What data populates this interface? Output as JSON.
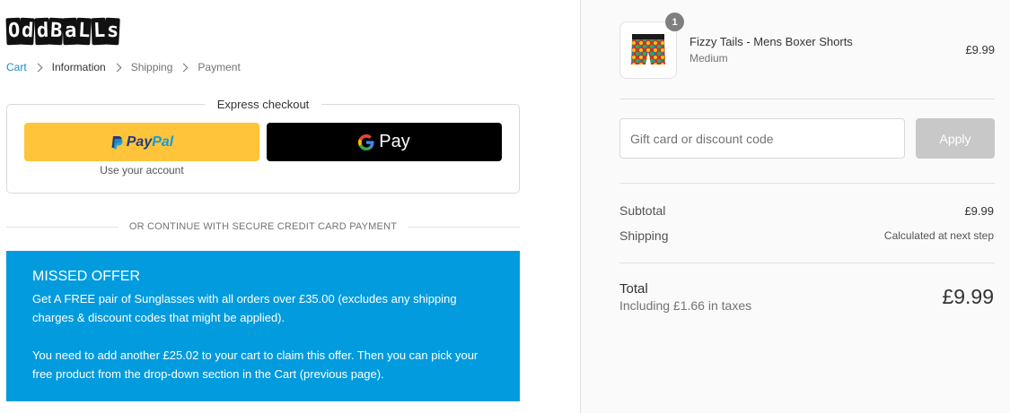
{
  "brand": {
    "logo_letters": [
      "O",
      "d",
      "d",
      "B",
      "a",
      "L",
      "L",
      "s"
    ]
  },
  "breadcrumb": {
    "items": [
      {
        "label": "Cart"
      },
      {
        "label": "Information"
      },
      {
        "label": "Shipping"
      },
      {
        "label": "Payment"
      }
    ]
  },
  "express_checkout": {
    "title": "Express checkout",
    "paypal": {
      "logo_part1": "Pay",
      "logo_part2": "Pal",
      "sublabel": "Use your account"
    },
    "gpay": {
      "label": "Pay"
    }
  },
  "divider": {
    "label": "OR CONTINUE WITH SECURE CREDIT CARD PAYMENT"
  },
  "offer": {
    "title": "MISSED OFFER",
    "paragraph1": "Get A FREE pair of Sunglasses with all orders over £35.00 (excludes any shipping charges & discount codes that might be applied).",
    "paragraph2": "You need to add another £25.02 to your cart to claim this offer. Then you can pick your free product from the drop-down section in the Cart (previous page)."
  },
  "cart": {
    "item": {
      "quantity": "1",
      "name": "Fizzy Tails - Mens Boxer Shorts",
      "variant": "Medium",
      "price": "£9.99"
    },
    "discount": {
      "placeholder": "Gift card or discount code",
      "value": "",
      "apply_label": "Apply"
    },
    "summary": {
      "subtotal_label": "Subtotal",
      "subtotal_value": "£9.99",
      "shipping_label": "Shipping",
      "shipping_value": "Calculated at next step"
    },
    "total": {
      "label": "Total",
      "tax_note": "Including £1.66 in taxes",
      "amount": "£9.99"
    }
  },
  "colors": {
    "link": "#1c8bd1",
    "offer_bg": "#019bde",
    "paypal_bg": "#ffc439",
    "apply_disabled": "#c8c8c8"
  }
}
